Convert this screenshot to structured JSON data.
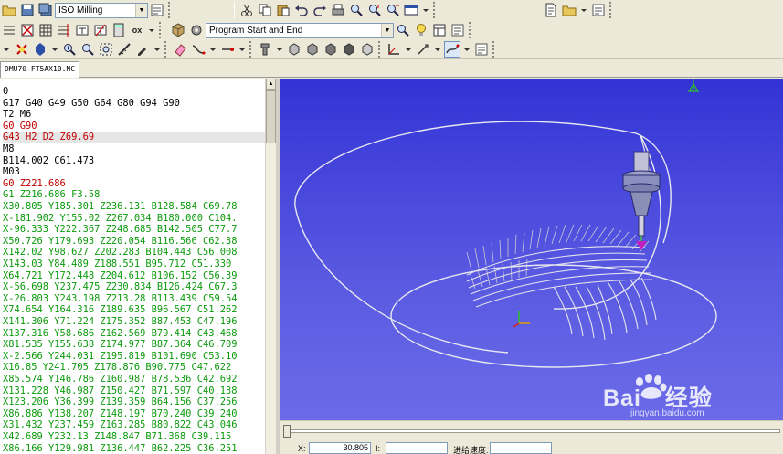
{
  "toolbar": {
    "machine_type": "ISO Milling",
    "program_section": "Program Start and End",
    "ox_label": "ox"
  },
  "file_tab": "DMU70-FT5AX10.NC",
  "code_lines": [
    {
      "text": "0",
      "color": "black"
    },
    {
      "text": "G17 G40 G49 G50 G64 G80 G94 G90",
      "color": "black"
    },
    {
      "text": "T2 M6",
      "color": "black"
    },
    {
      "text": "G0 G90",
      "color": "red"
    },
    {
      "text": "G43 H2 D2 Z69.69",
      "color": "red",
      "highlighted": true
    },
    {
      "text": "M8",
      "color": "black"
    },
    {
      "text": "B114.002 C61.473",
      "color": "black"
    },
    {
      "text": "M03",
      "color": "black"
    },
    {
      "text": "G0 Z221.686",
      "color": "red"
    },
    {
      "text": "G1 Z216.686 F3.58",
      "color": "green"
    },
    {
      "text": "X30.805 Y185.301 Z236.131 B128.584 C69.78",
      "color": "green"
    },
    {
      "text": "X-181.902 Y155.02 Z267.034 B180.000 C104.",
      "color": "green"
    },
    {
      "text": "X-96.333 Y222.367 Z248.685 B142.505 C77.7",
      "color": "green"
    },
    {
      "text": "X50.726 Y179.693 Z220.054 B116.566 C62.38",
      "color": "green"
    },
    {
      "text": "X142.02 Y98.627 Z202.283 B104.443 C56.008",
      "color": "green"
    },
    {
      "text": "X143.03 Y84.489 Z188.551 B95.712 C51.330",
      "color": "green"
    },
    {
      "text": "X64.721 Y172.448 Z204.612 B106.152 C56.39",
      "color": "green"
    },
    {
      "text": "X-56.698 Y237.475 Z230.834 B126.424 C67.3",
      "color": "green"
    },
    {
      "text": "X-26.803 Y243.198 Z213.28 B113.439 C59.54",
      "color": "green"
    },
    {
      "text": "X74.654 Y164.316 Z189.635 B96.567 C51.262",
      "color": "green"
    },
    {
      "text": "X141.306 Y71.224 Z175.352 B87.453 C47.196",
      "color": "green"
    },
    {
      "text": "X137.316 Y58.686 Z162.569 B79.414 C43.468",
      "color": "green"
    },
    {
      "text": "X81.535 Y155.638 Z174.977 B87.364 C46.709",
      "color": "green"
    },
    {
      "text": "X-2.566 Y244.031 Z195.819 B101.690 C53.10",
      "color": "green"
    },
    {
      "text": "X16.85 Y241.705 Z178.876 B90.775 C47.622",
      "color": "green"
    },
    {
      "text": "X85.574 Y146.786 Z160.987 B78.536 C42.692",
      "color": "green"
    },
    {
      "text": "X131.228 Y46.987 Z150.427 B71.597 C40.138",
      "color": "green"
    },
    {
      "text": "X123.206 Y36.399 Z139.359 B64.156 C37.256",
      "color": "green"
    },
    {
      "text": "X86.886 Y138.207 Z148.197 B70.240 C39.240",
      "color": "green"
    },
    {
      "text": "X31.432 Y237.459 Z163.285 B80.822 C43.046",
      "color": "green"
    },
    {
      "text": "X42.689 Y232.13 Z148.847 B71.368 C39.115",
      "color": "green"
    },
    {
      "text": "X86.166 Y129.981 Z136.447 B62.225 C36.251",
      "color": "green"
    }
  ],
  "watermark": {
    "brand": "Bai",
    "brand_suffix": "经验",
    "url": "jingyan.baidu.com"
  },
  "bottom": {
    "x_label": "X:",
    "x_value": "30.805",
    "i_label": "I:",
    "i_value": "",
    "feed_label": "进给速度:",
    "feed_value": ""
  },
  "colors": {
    "viewport_top": "#3333d6",
    "viewport_bottom": "#6b6be8",
    "toolpath": "#e8e8f0",
    "code_red": "#c00000",
    "code_green": "#0a9a0a"
  }
}
